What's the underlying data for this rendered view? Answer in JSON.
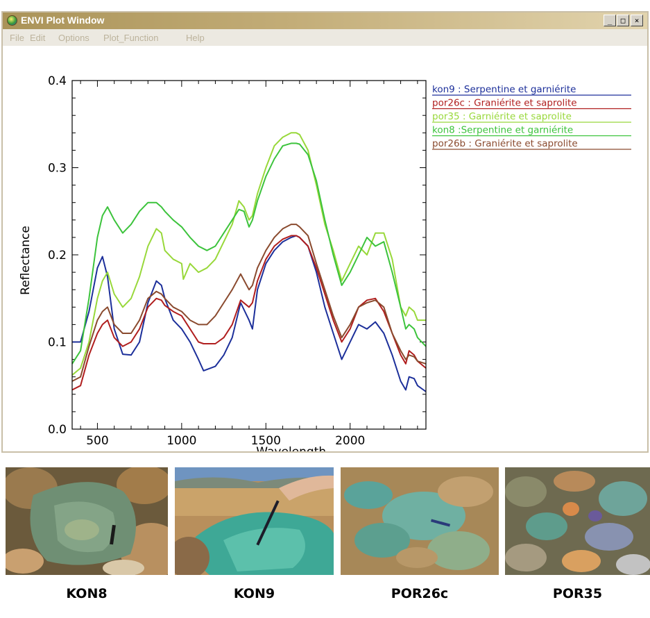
{
  "window": {
    "title": "ENVI Plot Window",
    "controls": {
      "minimize": "_",
      "maximize": "□",
      "close": "×"
    }
  },
  "menu": [
    "File",
    "Edit",
    "Options",
    "Plot_Function",
    "Help"
  ],
  "chart_data": {
    "type": "line",
    "xlabel": "Wavelength",
    "ylabel": "Reflectance",
    "xlim": [
      350,
      2450
    ],
    "ylim": [
      0.0,
      0.4
    ],
    "xticks": [
      500,
      1000,
      1500,
      2000
    ],
    "yticks": [
      "0.0",
      "0.1",
      "0.2",
      "0.3",
      "0.4"
    ],
    "legend_position": "outside-right-top",
    "series": [
      {
        "name": "kon9 : Serpentine et garniérite",
        "color": "#1c2f9a",
        "x": [
          350,
          400,
          450,
          500,
          530,
          560,
          600,
          650,
          700,
          750,
          800,
          850,
          880,
          900,
          950,
          1000,
          1050,
          1100,
          1130,
          1200,
          1250,
          1300,
          1350,
          1400,
          1420,
          1450,
          1500,
          1550,
          1600,
          1650,
          1680,
          1700,
          1750,
          1800,
          1850,
          1900,
          1950,
          2000,
          2050,
          2100,
          2150,
          2200,
          2250,
          2300,
          2330,
          2350,
          2380,
          2400,
          2450
        ],
        "y": [
          0.1,
          0.1,
          0.135,
          0.185,
          0.198,
          0.175,
          0.115,
          0.086,
          0.085,
          0.1,
          0.145,
          0.17,
          0.165,
          0.15,
          0.125,
          0.115,
          0.1,
          0.08,
          0.067,
          0.072,
          0.085,
          0.105,
          0.145,
          0.125,
          0.115,
          0.16,
          0.19,
          0.205,
          0.215,
          0.22,
          0.222,
          0.22,
          0.21,
          0.18,
          0.14,
          0.11,
          0.08,
          0.1,
          0.12,
          0.115,
          0.123,
          0.11,
          0.085,
          0.055,
          0.045,
          0.06,
          0.058,
          0.05,
          0.043
        ]
      },
      {
        "name": "por26c : Graniérite et saprolite",
        "color": "#b01e1e",
        "x": [
          350,
          400,
          450,
          500,
          530,
          560,
          600,
          650,
          700,
          750,
          800,
          850,
          880,
          900,
          950,
          1000,
          1050,
          1100,
          1130,
          1200,
          1250,
          1300,
          1350,
          1400,
          1420,
          1450,
          1500,
          1550,
          1600,
          1650,
          1680,
          1700,
          1750,
          1800,
          1850,
          1900,
          1950,
          2000,
          2050,
          2100,
          2150,
          2200,
          2250,
          2300,
          2330,
          2350,
          2380,
          2400,
          2450
        ],
        "y": [
          0.045,
          0.05,
          0.085,
          0.11,
          0.12,
          0.125,
          0.105,
          0.095,
          0.1,
          0.115,
          0.14,
          0.15,
          0.148,
          0.142,
          0.135,
          0.13,
          0.115,
          0.1,
          0.098,
          0.098,
          0.105,
          0.12,
          0.148,
          0.14,
          0.145,
          0.17,
          0.195,
          0.21,
          0.218,
          0.222,
          0.222,
          0.22,
          0.21,
          0.185,
          0.155,
          0.125,
          0.1,
          0.115,
          0.14,
          0.148,
          0.15,
          0.135,
          0.11,
          0.085,
          0.075,
          0.09,
          0.085,
          0.078,
          0.07
        ]
      },
      {
        "name": "por35 : Garniérite et saprolite",
        "color": "#98d83a",
        "x": [
          350,
          400,
          450,
          500,
          530,
          560,
          600,
          650,
          700,
          750,
          800,
          850,
          880,
          900,
          950,
          1000,
          1010,
          1050,
          1100,
          1150,
          1200,
          1250,
          1300,
          1340,
          1370,
          1400,
          1420,
          1450,
          1500,
          1550,
          1600,
          1650,
          1680,
          1700,
          1750,
          1800,
          1850,
          1900,
          1950,
          2000,
          2050,
          2100,
          2150,
          2200,
          2250,
          2300,
          2330,
          2350,
          2380,
          2400,
          2450
        ],
        "y": [
          0.062,
          0.07,
          0.1,
          0.15,
          0.17,
          0.18,
          0.155,
          0.14,
          0.15,
          0.175,
          0.21,
          0.23,
          0.225,
          0.205,
          0.195,
          0.19,
          0.172,
          0.19,
          0.18,
          0.185,
          0.195,
          0.215,
          0.235,
          0.262,
          0.255,
          0.24,
          0.245,
          0.27,
          0.3,
          0.325,
          0.335,
          0.34,
          0.34,
          0.338,
          0.32,
          0.28,
          0.235,
          0.205,
          0.17,
          0.19,
          0.21,
          0.2,
          0.225,
          0.225,
          0.195,
          0.14,
          0.13,
          0.14,
          0.135,
          0.125,
          0.125
        ]
      },
      {
        "name": "kon8 :Serpentine et garniérite",
        "color": "#3cc33c",
        "x": [
          350,
          400,
          450,
          500,
          530,
          560,
          600,
          650,
          700,
          750,
          800,
          850,
          880,
          900,
          950,
          1000,
          1050,
          1100,
          1150,
          1200,
          1250,
          1300,
          1340,
          1370,
          1400,
          1420,
          1450,
          1500,
          1550,
          1600,
          1650,
          1680,
          1700,
          1750,
          1800,
          1850,
          1900,
          1950,
          2000,
          2050,
          2100,
          2150,
          2200,
          2250,
          2300,
          2330,
          2350,
          2380,
          2400,
          2450
        ],
        "y": [
          0.075,
          0.09,
          0.15,
          0.22,
          0.245,
          0.255,
          0.24,
          0.225,
          0.235,
          0.25,
          0.26,
          0.26,
          0.255,
          0.25,
          0.24,
          0.232,
          0.22,
          0.21,
          0.205,
          0.21,
          0.225,
          0.24,
          0.252,
          0.25,
          0.232,
          0.24,
          0.262,
          0.29,
          0.31,
          0.325,
          0.328,
          0.328,
          0.327,
          0.315,
          0.285,
          0.24,
          0.2,
          0.165,
          0.18,
          0.2,
          0.22,
          0.21,
          0.215,
          0.18,
          0.14,
          0.115,
          0.12,
          0.115,
          0.105,
          0.095
        ]
      },
      {
        "name": "por26b : Graniérite et saprolite",
        "color": "#8a4a2e",
        "x": [
          350,
          400,
          450,
          500,
          530,
          560,
          600,
          650,
          700,
          750,
          800,
          850,
          880,
          900,
          950,
          1000,
          1050,
          1100,
          1150,
          1200,
          1250,
          1300,
          1350,
          1400,
          1420,
          1450,
          1500,
          1550,
          1600,
          1650,
          1680,
          1700,
          1750,
          1800,
          1850,
          1900,
          1950,
          2000,
          2050,
          2100,
          2150,
          2200,
          2250,
          2300,
          2330,
          2350,
          2380,
          2400,
          2450
        ],
        "y": [
          0.055,
          0.06,
          0.095,
          0.125,
          0.135,
          0.14,
          0.12,
          0.11,
          0.11,
          0.125,
          0.15,
          0.158,
          0.155,
          0.15,
          0.14,
          0.135,
          0.125,
          0.12,
          0.12,
          0.13,
          0.145,
          0.16,
          0.178,
          0.16,
          0.165,
          0.185,
          0.205,
          0.22,
          0.23,
          0.235,
          0.235,
          0.232,
          0.222,
          0.19,
          0.16,
          0.13,
          0.105,
          0.12,
          0.14,
          0.145,
          0.148,
          0.14,
          0.11,
          0.09,
          0.08,
          0.085,
          0.083,
          0.078,
          0.075
        ]
      }
    ]
  },
  "photos": [
    {
      "label": "KON8"
    },
    {
      "label": "KON9"
    },
    {
      "label": "POR26c"
    },
    {
      "label": "POR35"
    }
  ]
}
